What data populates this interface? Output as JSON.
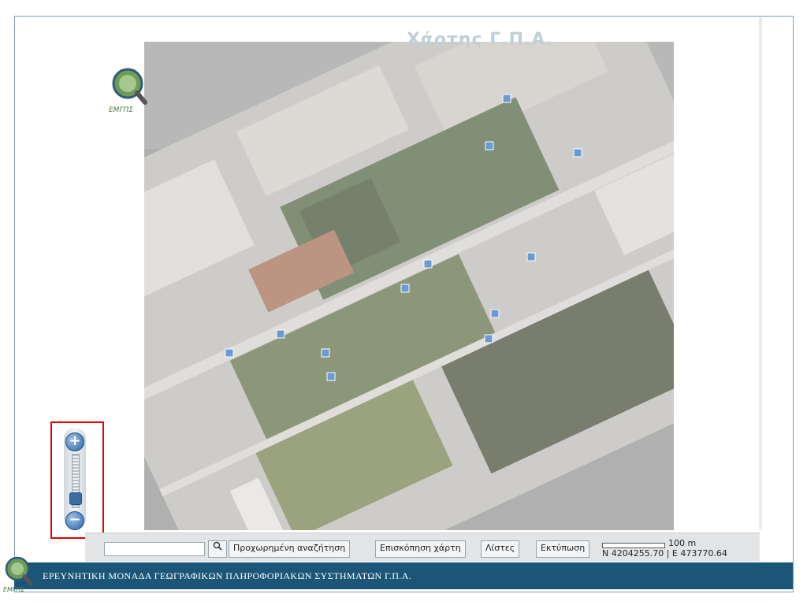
{
  "map": {
    "title": "Χάρτης Γ.Π.Α.",
    "logo_label": "ΕΜΓΠΣ"
  },
  "zoom": {
    "zoom_in_label": "+",
    "zoom_out_label": "−",
    "level_fraction": 0.2
  },
  "toolbar": {
    "search_value": "",
    "search_icon": "magnifier-icon",
    "buttons": [
      "Προχωρημένη αναζήτηση",
      "Επισκόπηση χάρτη",
      "Λίστες",
      "Εκτύπωση"
    ]
  },
  "scale": {
    "scale_label": "100 m",
    "coordinates": "N 4204255.70 | E 473770.64"
  },
  "footer": {
    "text": "ΕΡΕΥΝΗΤΙΚΗ ΜΟΝΑΔΑ ΓΕΩΓΡΑΦΙΚΩΝ ΠΛΗΡΟΦΟΡΙΑΚΩΝ ΣΥΣΤΗΜΑΤΩΝ Γ.Π.Α.",
    "logo_label": "ΕΜΓΠΣ"
  }
}
